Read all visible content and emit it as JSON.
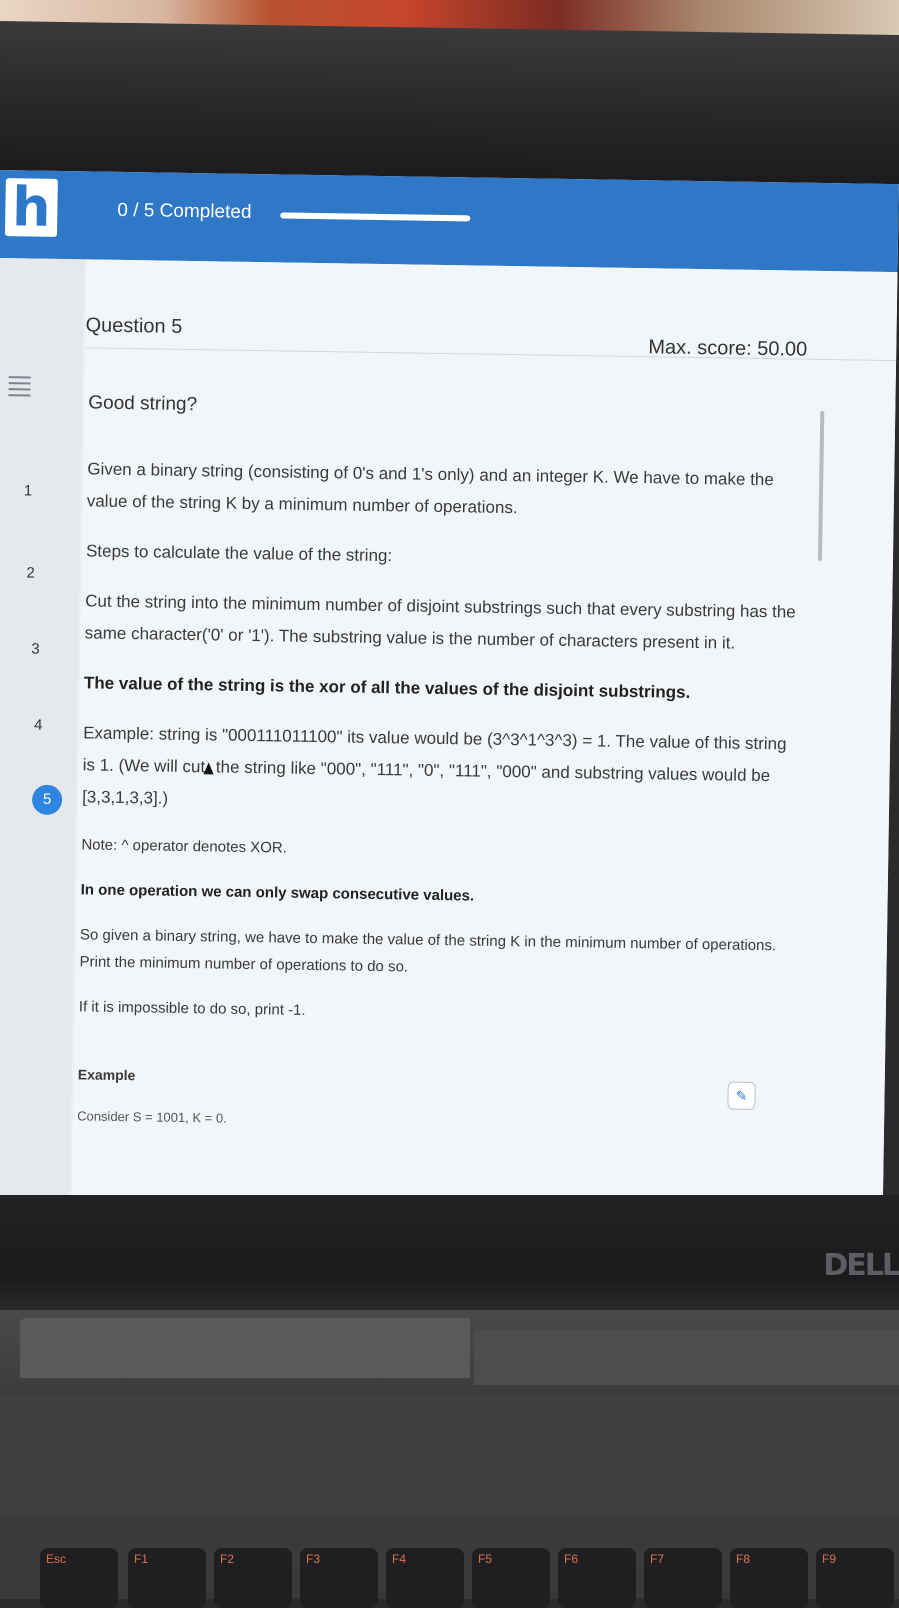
{
  "app": {
    "logo_letter": "h",
    "progress_label": "0 / 5 Completed",
    "progress_fraction": 0.0
  },
  "sidebar": {
    "questions": [
      "1",
      "2",
      "3",
      "4",
      "5"
    ],
    "active_question": "5"
  },
  "question": {
    "label": "Question  5",
    "max_score": "Max. score: 50.00",
    "title": "Good string?",
    "paragraphs": {
      "p1": "Given a binary string (consisting of 0's and 1's only) and an integer K. We have to make the value of the string K by a minimum number of operations.",
      "p2": "Steps to calculate the value of the string:",
      "p3": "Cut the string into the minimum number of disjoint substrings such that every substring has the same character('0' or '1'). The substring value is the number of characters present in it.",
      "p4": "The value of the string is the xor of all the values of the disjoint substrings.",
      "p5a": "Example: string is \"000111011100\" its value would be (3^3^1^3^3) = 1. The value of this string is 1. (We will cut",
      "p5b": "the string like \"000\", \"111\", \"0\", \"111\", \"000\" and substring values would be [3,3,1,3,3].)",
      "p6": "Note: ^ operator denotes XOR.",
      "p7": "In one operation we can only swap consecutive values.",
      "p8": "So given a binary string, we have to make the value of the string K in the minimum number of operations. Print the minimum number of operations to do so.",
      "p9": "If it is impossible to do so, print -1.",
      "example_heading": "Example",
      "consider": "Consider S = 1001, K = 0."
    }
  },
  "hardware": {
    "brand": "DELL",
    "keys": [
      "Esc",
      "F1",
      "F2",
      "F3",
      "F4",
      "F5",
      "F6",
      "F7",
      "F8",
      "F9"
    ]
  },
  "colors": {
    "topbar": "#2f78c8",
    "active_badge": "#2f86e0",
    "page_bg": "#f3f6f8"
  },
  "icons": {
    "menu": "hamburger-icon",
    "notes": "notes-icon"
  }
}
